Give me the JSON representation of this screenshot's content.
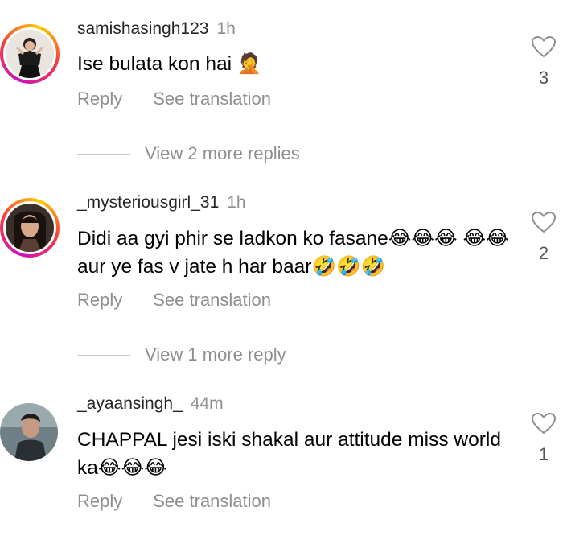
{
  "comments": [
    {
      "username": "samishasingh123",
      "time": "1h",
      "text": "Ise bulata kon hai 🤦",
      "reply_label": "Reply",
      "translate_label": "See translation",
      "likes": "3",
      "has_story_ring": true,
      "more_replies": "View 2 more replies"
    },
    {
      "username": "_mysteriousgirl_31",
      "time": "1h",
      "text": "Didi aa gyi phir se ladkon ko fasane😂😂😂 😂😂 aur ye fas v jate h har baar🤣🤣🤣",
      "reply_label": "Reply",
      "translate_label": "See translation",
      "likes": "2",
      "has_story_ring": true,
      "more_replies": "View 1 more reply"
    },
    {
      "username": "_ayaansingh_",
      "time": "44m",
      "text": "CHAPPAL jesi iski shakal aur attitude miss world ka😂😂😂",
      "reply_label": "Reply",
      "translate_label": "See translation",
      "likes": "1",
      "has_story_ring": false
    }
  ]
}
